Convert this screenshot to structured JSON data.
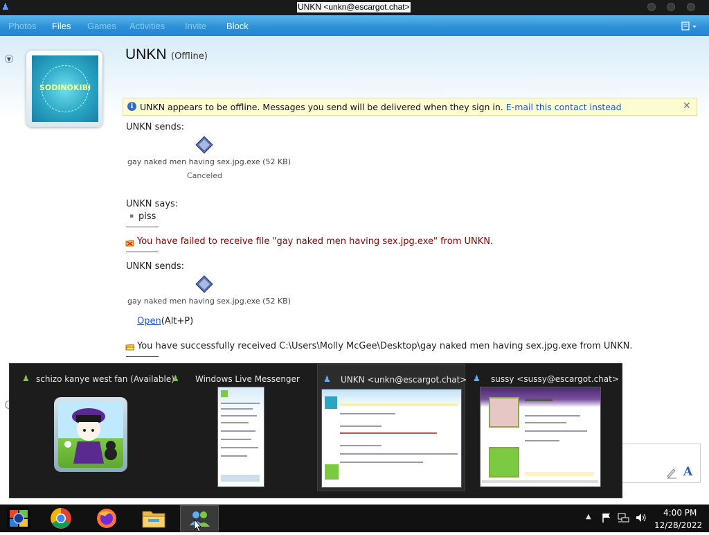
{
  "window": {
    "title": "UNKN <unkn@escargot.chat>"
  },
  "menu": {
    "items": [
      {
        "label": "Photos",
        "enabled": false
      },
      {
        "label": "Files",
        "enabled": true
      },
      {
        "label": "Games",
        "enabled": false
      },
      {
        "label": "Activities",
        "enabled": false
      },
      {
        "label": "Invite",
        "enabled": false
      },
      {
        "label": "Block",
        "enabled": true
      }
    ]
  },
  "contact": {
    "name": "UNKN",
    "status": "(Offline)",
    "avatar_text": "SODINOKIBI"
  },
  "infobar": {
    "text": "UNKN appears to be offline. Messages you send will be delivered when they sign in.",
    "link": "E-mail this contact instead",
    "close": "✕"
  },
  "conversation": {
    "send1": {
      "header": "UNKN sends:",
      "filename": "gay naked men having sex.jpg.exe (52 KB)",
      "status": "Canceled"
    },
    "say1": {
      "header": "UNKN says:",
      "bullet": "▪",
      "text": "piss"
    },
    "fail": {
      "text": "You have failed to receive file \"gay naked men having sex.jpg.exe\" from UNKN."
    },
    "send2": {
      "header": "UNKN sends:",
      "filename": "gay naked men having sex.jpg.exe (52 KB)",
      "open_label": "Open",
      "open_hint": "(Alt+P)"
    },
    "success": {
      "text": "You have successfully received C:\\Users\\Molly McGee\\Desktop\\gay naked men having sex.jpg.exe from UNKN."
    }
  },
  "previews": [
    {
      "title": "schizo kanye west fan (Available)"
    },
    {
      "title": "Windows Live Messenger"
    },
    {
      "title": "UNKN <unkn@escargot.chat>"
    },
    {
      "title": "sussy <sussy@escargot.chat>"
    }
  ],
  "taskbar": {
    "time": "4:00 PM",
    "date": "12/28/2022",
    "apps": [
      "start-orb",
      "chrome",
      "firefox",
      "file-explorer",
      "windows-live-messenger"
    ]
  },
  "colors": {
    "menu_bar": "#2a8fd6",
    "error_text": "#8b0000",
    "link": "#1a55c8"
  }
}
